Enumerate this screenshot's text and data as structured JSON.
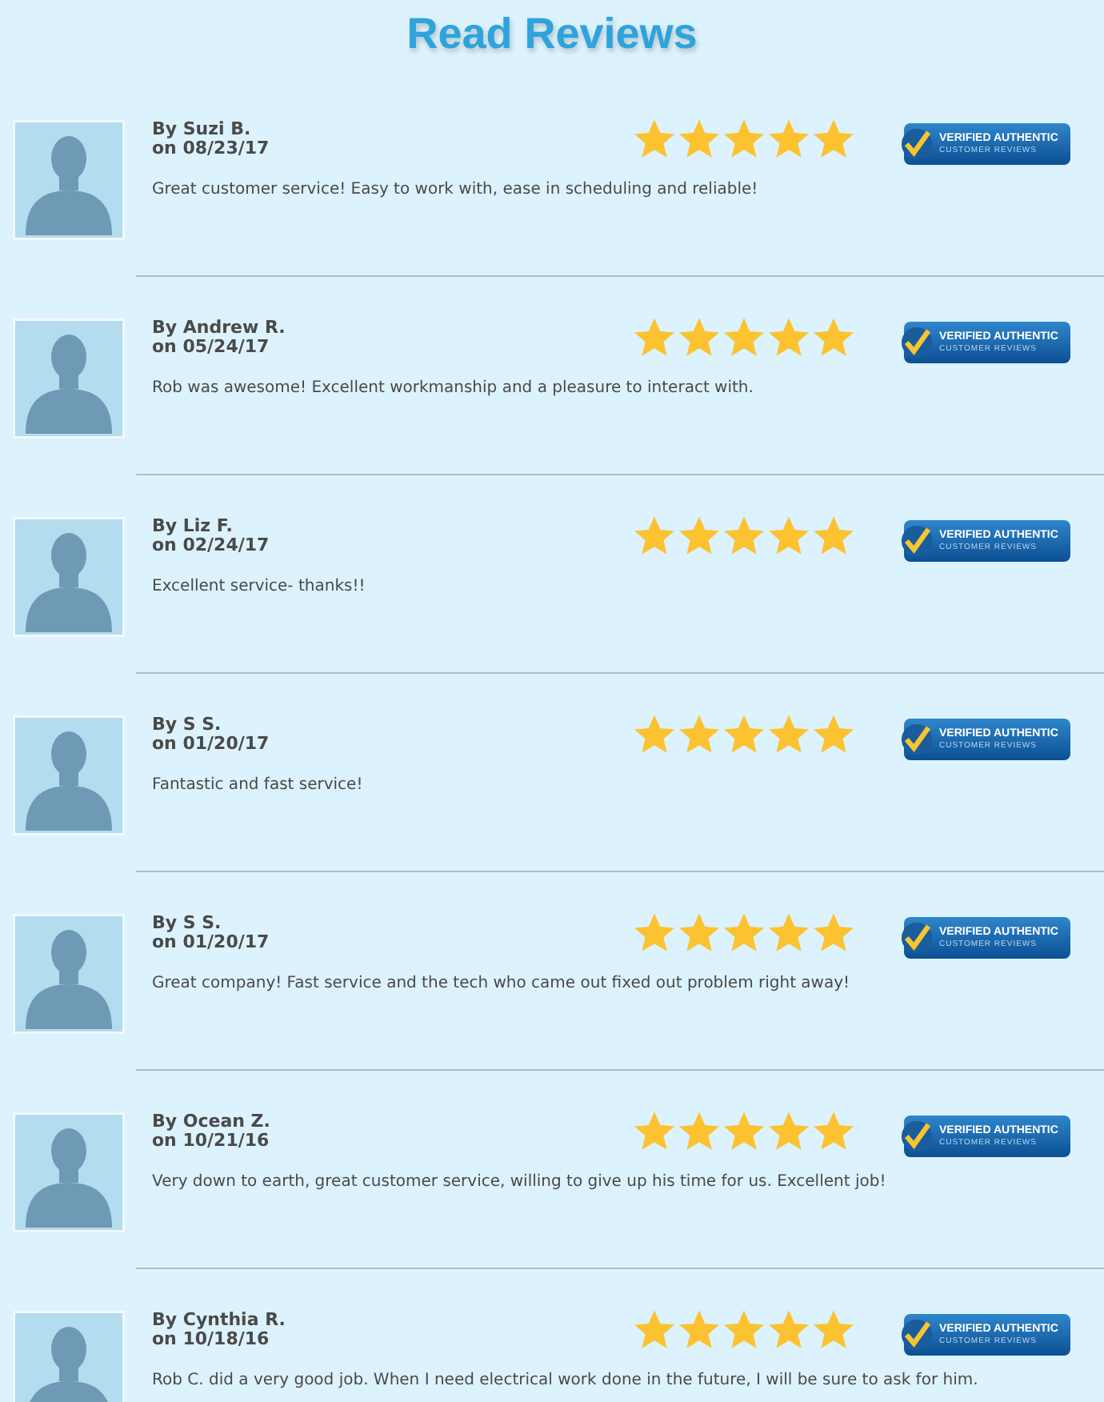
{
  "title": "Read Reviews",
  "reviews": [
    {
      "author": "By Suzi B.",
      "date": "on 08/23/17",
      "stars": 5,
      "text": "Great customer service! Easy to work with, ease in scheduling and reliable!",
      "badge": [
        "VERIFIED AUTHENTIC",
        "CUSTOMER REVIEWS"
      ]
    },
    {
      "author": "By Andrew R.",
      "date": "on 05/24/17",
      "stars": 5,
      "text": "Rob was awesome! Excellent workmanship and a pleasure to interact with.",
      "badge": [
        "VERIFIED AUTHENTIC",
        "CUSTOMER REVIEWS"
      ]
    },
    {
      "author": "By Liz F.",
      "date": "on 02/24/17",
      "stars": 5,
      "text": "Excellent service- thanks!!",
      "badge": [
        "VERIFIED AUTHENTIC",
        "CUSTOMER REVIEWS"
      ]
    },
    {
      "author": "By S S.",
      "date": "on 01/20/17",
      "stars": 5,
      "text": "Fantastic and fast service!",
      "badge": [
        "VERIFIED AUTHENTIC",
        "CUSTOMER REVIEWS"
      ]
    },
    {
      "author": "By S S.",
      "date": "on 01/20/17",
      "stars": 5,
      "text": "Great company! Fast service and the tech who came out fixed out problem right away!",
      "badge": [
        "VERIFIED AUTHENTIC",
        "CUSTOMER REVIEWS"
      ]
    },
    {
      "author": "By Ocean Z.",
      "date": "on 10/21/16",
      "stars": 5,
      "text": "Very down to earth, great customer service, willing to give up his time for us. Excellent job!",
      "badge": [
        "VERIFIED AUTHENTIC",
        "CUSTOMER REVIEWS"
      ]
    },
    {
      "author": "By Cynthia R.",
      "date": "on 10/18/16",
      "stars": 5,
      "text": "Rob C. did a very good job. When I need electrical work done in the future, I will be sure to ask for him.",
      "badge": [
        "VERIFIED AUTHENTIC",
        "CUSTOMER REVIEWS"
      ]
    }
  ]
}
